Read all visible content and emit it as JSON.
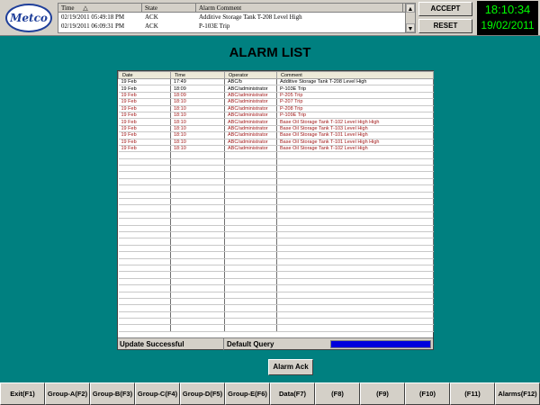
{
  "header": {
    "logo_text": "Metco",
    "mini_grid": {
      "columns": [
        "Time",
        "State",
        "Alarm Comment"
      ],
      "sort_indicator": "△",
      "rows": [
        {
          "time": "02/19/2011 05:49:18 PM",
          "state": "ACK",
          "comment": "Additive Storage Tank T-208 Level High"
        },
        {
          "time": "02/19/2011 06:09:31 PM",
          "state": "ACK",
          "comment": "P-103E Trip"
        }
      ]
    },
    "accept_label": "ACCEPT",
    "reset_label": "RESET",
    "clock_time": "18:10:34",
    "clock_date": "19/02/2011"
  },
  "page_title": "ALARM LIST",
  "alarm_table": {
    "columns": [
      "Date",
      "Time",
      "Operator",
      "Comment"
    ],
    "rows": [
      {
        "date": "19 Feb",
        "time": "17:49",
        "operator": "ABC/b",
        "comment": "Additive Storage Tank T-208 Level High",
        "state": "ack"
      },
      {
        "date": "19 Feb",
        "time": "18:09",
        "operator": "ABC/administrator",
        "comment": "P-103E Trip",
        "state": "ack"
      },
      {
        "date": "19 Feb",
        "time": "18:09",
        "operator": "ABC/administrator",
        "comment": "P-205 Trip",
        "state": "unack"
      },
      {
        "date": "19 Feb",
        "time": "18:10",
        "operator": "ABC/administrator",
        "comment": "P-207 Trip",
        "state": "unack"
      },
      {
        "date": "19 Feb",
        "time": "18:10",
        "operator": "ABC/administrator",
        "comment": "P-208 Trip",
        "state": "unack"
      },
      {
        "date": "19 Feb",
        "time": "18:10",
        "operator": "ABC/administrator",
        "comment": "P-109E Trip",
        "state": "unack"
      },
      {
        "date": "19 Feb",
        "time": "18:10",
        "operator": "ABC/administrator",
        "comment": "Base Oil Storage Tank T-102 Level High High",
        "state": "unack"
      },
      {
        "date": "19 Feb",
        "time": "18:10",
        "operator": "ABC/administrator",
        "comment": "Base Oil Storage Tank T-103 Level High",
        "state": "unack"
      },
      {
        "date": "19 Feb",
        "time": "18:10",
        "operator": "ABC/administrator",
        "comment": "Base Oil Storage Tank T-101 Level High",
        "state": "unack"
      },
      {
        "date": "19 Feb",
        "time": "18:10",
        "operator": "ABC/administrator",
        "comment": "Base Oil Storage Tank T-101 Level High High",
        "state": "unack"
      },
      {
        "date": "19 Feb",
        "time": "18:10",
        "operator": "ABC/administrator",
        "comment": "Base Oil Storage Tank T-102 Level High",
        "state": "unack"
      }
    ],
    "status_message": "Update Successful",
    "query_label": "Default Query",
    "progress": 1.0
  },
  "ack_button_label": "Alarm Ack",
  "function_keys": [
    "Exit(F1)",
    "Group-A(F2)",
    "Group-B(F3)",
    "Group-C(F4)",
    "Group-D(F5)",
    "Group-E(F6)",
    "Data(F7)",
    "(F8)",
    "(F9)",
    "(F10)",
    "(F11)",
    "Alarms(F12)"
  ],
  "colors": {
    "background": "#008080",
    "clock_text": "#00ff00",
    "unack_text": "#a01818",
    "progress_fill": "#0000dd"
  }
}
